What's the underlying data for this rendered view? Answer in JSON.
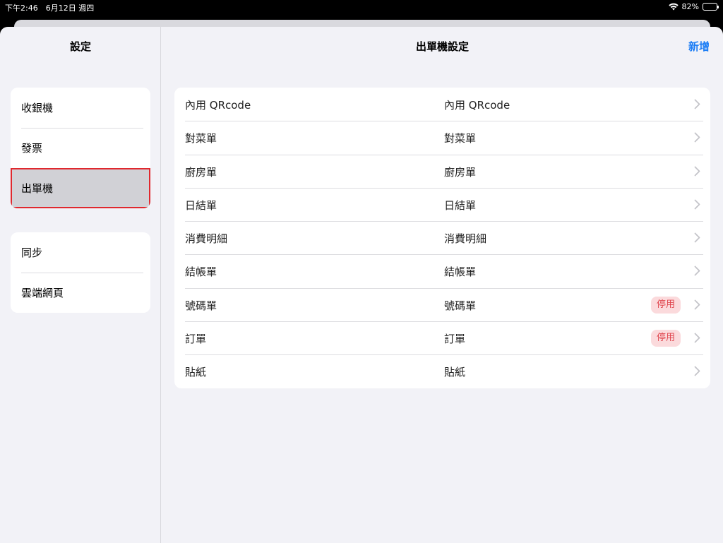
{
  "status_bar": {
    "time_date": "下午2:46　6月12日 週四",
    "battery": "82%",
    "battery_level": 0.82,
    "wifi_icon": "wifi-icon",
    "battery_icon": "battery-icon"
  },
  "sidebar": {
    "title": "設定",
    "groups": [
      {
        "items": [
          {
            "label": "收銀機"
          },
          {
            "label": "發票"
          },
          {
            "label": "出單機",
            "selected": true
          }
        ]
      },
      {
        "items": [
          {
            "label": "同步"
          },
          {
            "label": "雲端網頁"
          }
        ]
      }
    ]
  },
  "detail": {
    "title": "出單機設定",
    "add_label": "新增",
    "rows": [
      {
        "name": "內用 QRcode",
        "printer": "內用 QRcode",
        "badge": ""
      },
      {
        "name": "對菜單",
        "printer": "對菜單",
        "badge": ""
      },
      {
        "name": "廚房單",
        "printer": "廚房單",
        "badge": ""
      },
      {
        "name": "日結單",
        "printer": "日結單",
        "badge": ""
      },
      {
        "name": "消費明細",
        "printer": "消費明細",
        "badge": ""
      },
      {
        "name": "結帳單",
        "printer": "結帳單",
        "badge": ""
      },
      {
        "name": "號碼單",
        "printer": "號碼單",
        "badge": "停用"
      },
      {
        "name": "訂單",
        "printer": "訂單",
        "badge": "停用"
      },
      {
        "name": "貼紙",
        "printer": "貼紙",
        "badge": ""
      }
    ]
  },
  "colors": {
    "accent": "#1a7cf5",
    "badge_text": "#e0474f",
    "badge_bg": "#fbdadc",
    "selection_outline": "#e0282e",
    "background": "#f2f2f7"
  }
}
